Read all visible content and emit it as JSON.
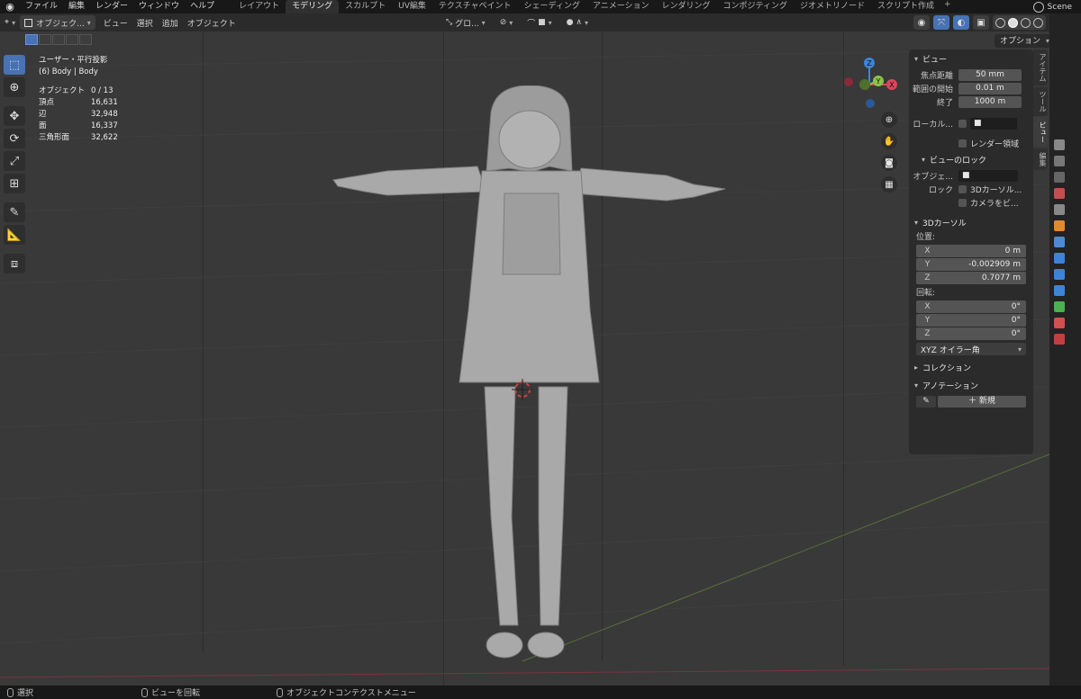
{
  "topbar": {
    "menus": [
      "ファイル",
      "編集",
      "レンダー",
      "ウィンドウ",
      "ヘルプ"
    ],
    "workspaces": [
      {
        "label": "レイアウト",
        "active": false
      },
      {
        "label": "モデリング",
        "active": true
      },
      {
        "label": "スカルプト",
        "active": false
      },
      {
        "label": "UV編集",
        "active": false
      },
      {
        "label": "テクスチャペイント",
        "active": false
      },
      {
        "label": "シェーディング",
        "active": false
      },
      {
        "label": "アニメーション",
        "active": false
      },
      {
        "label": "レンダリング",
        "active": false
      },
      {
        "label": "コンポジティング",
        "active": false
      },
      {
        "label": "ジオメトリノード",
        "active": false
      },
      {
        "label": "スクリプト作成",
        "active": false
      }
    ],
    "add_tab": "+",
    "scene": "Scene"
  },
  "header": {
    "mode": "オブジェク...",
    "menus": [
      "ビュー",
      "選択",
      "追加",
      "オブジェクト"
    ],
    "transform_orientation": "グロ...",
    "options": "オプション"
  },
  "overlay": {
    "view_name": "ユーザー・平行投影",
    "object_name": "(6) Body | Body",
    "stats": [
      {
        "label": "オブジェクト",
        "value": "0 / 13"
      },
      {
        "label": "頂点",
        "value": "16,631"
      },
      {
        "label": "辺",
        "value": "32,948"
      },
      {
        "label": "面",
        "value": "16,337"
      },
      {
        "label": "三角形面",
        "value": "32,622"
      }
    ]
  },
  "gizmo": {
    "z": "Z",
    "y": "Y",
    "x": "X"
  },
  "npanel": {
    "view_section": "ビュー",
    "focal_label": "焦点距離",
    "focal_value": "50 mm",
    "clip_start_label": "範囲の開始",
    "clip_start_value": "0.01 m",
    "clip_end_label": "終了",
    "clip_end_value": "1000 m",
    "local_camera_label": "ローカル...",
    "render_region_label": "レンダー領域",
    "view_lock_section": "ビューのロック",
    "lock_object_label": "オブジェ...",
    "lock_label": "ロック",
    "lock_3dcursor": "3Dカーソル...",
    "lock_camera": "カメラをビ...",
    "cursor_section": "3Dカーソル",
    "location_label": "位置:",
    "location": [
      {
        "axis": "X",
        "value": "0 m"
      },
      {
        "axis": "Y",
        "value": "-0.002909 m"
      },
      {
        "axis": "Z",
        "value": "0.7077 m"
      }
    ],
    "rotation_label": "回転:",
    "rotation": [
      {
        "axis": "X",
        "value": "0°"
      },
      {
        "axis": "Y",
        "value": "0°"
      },
      {
        "axis": "Z",
        "value": "0°"
      }
    ],
    "rotation_mode": "XYZ オイラー角",
    "collection_section": "コレクション",
    "annotation_section": "アノテーション",
    "annotation_new": "新規"
  },
  "sidebar_tabs": [
    {
      "label": "アイテム",
      "active": false
    },
    {
      "label": "ツール",
      "active": false
    },
    {
      "label": "ビュー",
      "active": true
    },
    {
      "label": "編集",
      "active": false
    }
  ],
  "statusbar": {
    "select": "選択",
    "rotate_view": "ビューを回転",
    "context_menu": "オブジェクトコンテクストメニュー"
  },
  "colors": {
    "accent": "#4772b3",
    "viewport_bg": "#393939",
    "axis_x": "#e0445a",
    "axis_y": "#8bc34a",
    "axis_z": "#3d84d6"
  }
}
